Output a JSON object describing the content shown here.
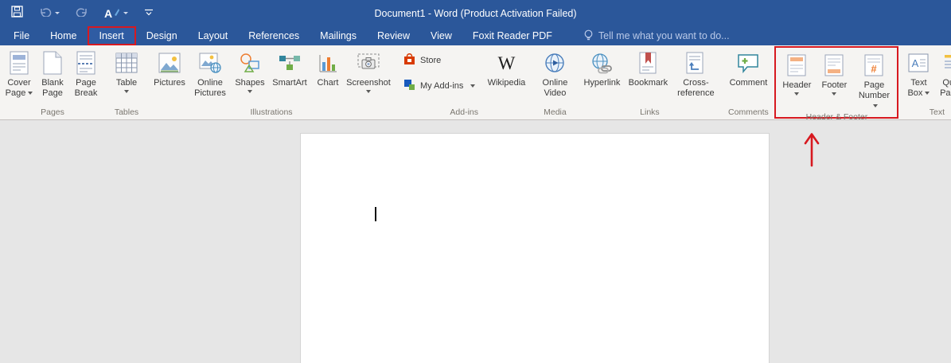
{
  "colors": {
    "titlebar_blue": "#2b579a",
    "ribbon_background": "#f5f4f2",
    "document_background": "#e6e6e6",
    "annotation_red": "#d71920"
  },
  "titlebar": {
    "title": "Document1 - Word (Product Activation Failed)"
  },
  "tabs": {
    "items": [
      {
        "label": "File"
      },
      {
        "label": "Home"
      },
      {
        "label": "Insert"
      },
      {
        "label": "Design"
      },
      {
        "label": "Layout"
      },
      {
        "label": "References"
      },
      {
        "label": "Mailings"
      },
      {
        "label": "Review"
      },
      {
        "label": "View"
      },
      {
        "label": "Foxit Reader PDF"
      }
    ],
    "active_tab": "Insert",
    "tellme": "Tell me what you want to do..."
  },
  "ribbon": {
    "groups": [
      {
        "name": "Pages",
        "buttons": [
          {
            "label": "Cover Page",
            "dropdown": true
          },
          {
            "label": "Blank Page",
            "dropdown": false
          },
          {
            "label": "Page Break",
            "dropdown": false
          }
        ]
      },
      {
        "name": "Tables",
        "buttons": [
          {
            "label": "Table",
            "dropdown": true
          }
        ]
      },
      {
        "name": "Illustrations",
        "buttons": [
          {
            "label": "Pictures",
            "dropdown": false
          },
          {
            "label": "Online Pictures",
            "dropdown": false
          },
          {
            "label": "Shapes",
            "dropdown": true
          },
          {
            "label": "SmartArt",
            "dropdown": false
          },
          {
            "label": "Chart",
            "dropdown": false
          },
          {
            "label": "Screenshot",
            "dropdown": true
          }
        ]
      },
      {
        "name": "Add-ins",
        "buttons": [
          {
            "label": "Store",
            "dropdown": false
          },
          {
            "label": "My Add-ins",
            "dropdown": true
          },
          {
            "label": "Wikipedia",
            "dropdown": false
          }
        ]
      },
      {
        "name": "Media",
        "buttons": [
          {
            "label": "Online Video",
            "dropdown": false
          }
        ]
      },
      {
        "name": "Links",
        "buttons": [
          {
            "label": "Hyperlink",
            "dropdown": false
          },
          {
            "label": "Bookmark",
            "dropdown": false
          },
          {
            "label": "Cross-reference",
            "dropdown": false
          }
        ]
      },
      {
        "name": "Comments",
        "buttons": [
          {
            "label": "Comment",
            "dropdown": false
          }
        ]
      },
      {
        "name": "Header & Footer",
        "highlighted": true,
        "buttons": [
          {
            "label": "Header",
            "dropdown": true
          },
          {
            "label": "Footer",
            "dropdown": true
          },
          {
            "label": "Page Number",
            "dropdown": true
          }
        ]
      },
      {
        "name": "Text",
        "buttons": [
          {
            "label": "Text Box",
            "dropdown": true
          },
          {
            "label": "Quick Parts",
            "dropdown": true
          }
        ]
      }
    ]
  },
  "icons": {
    "wikipedia_glyph": "W",
    "page_number_glyph": "#",
    "text_box_glyph": "A",
    "qat_font_glyph": "A"
  },
  "document": {
    "cursor_visible": true
  }
}
